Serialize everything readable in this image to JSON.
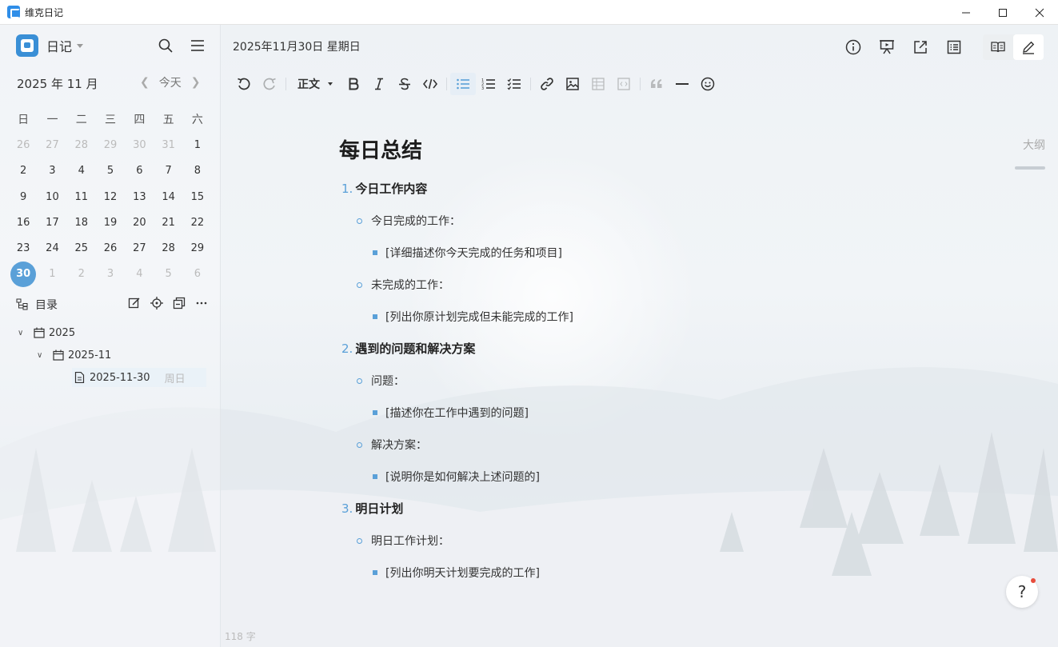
{
  "window": {
    "title": "维克日记",
    "minimize_icon": "minimize-icon",
    "maximize_icon": "maximize-icon",
    "close_icon": "close-icon"
  },
  "sidebar": {
    "title": "日记",
    "month_label": "2025 年 11 月",
    "today_label": "今天",
    "weekdays": [
      "日",
      "一",
      "二",
      "三",
      "四",
      "五",
      "六"
    ],
    "calendar": [
      [
        "26",
        "27",
        "28",
        "29",
        "30",
        "31",
        "1"
      ],
      [
        "2",
        "3",
        "4",
        "5",
        "6",
        "7",
        "8"
      ],
      [
        "9",
        "10",
        "11",
        "12",
        "13",
        "14",
        "15"
      ],
      [
        "16",
        "17",
        "18",
        "19",
        "20",
        "21",
        "22"
      ],
      [
        "23",
        "24",
        "25",
        "26",
        "27",
        "28",
        "29"
      ],
      [
        "30",
        "1",
        "2",
        "3",
        "4",
        "5",
        "6"
      ]
    ],
    "selected_day": "30",
    "toc_title": "目录",
    "tree": {
      "year": "2025",
      "month": "2025-11",
      "entry": "2025-11-30",
      "entry_weekday": "周日"
    }
  },
  "main": {
    "date_label": "2025年11月30日 星期日",
    "style_select": "正文",
    "outline_label": "大纲",
    "word_count": "118 字",
    "help_label": "?",
    "doc": {
      "title": "每日总结",
      "sections": [
        {
          "num": "1.",
          "heading": "今日工作内容",
          "items": [
            {
              "label": "今日完成的工作：",
              "detail": "[详细描述你今天完成的任务和项目]"
            },
            {
              "label": "未完成的工作：",
              "detail": "[列出你原计划完成但未能完成的工作]"
            }
          ]
        },
        {
          "num": "2.",
          "heading": "遇到的问题和解决方案",
          "items": [
            {
              "label": "问题：",
              "detail": "[描述你在工作中遇到的问题]"
            },
            {
              "label": "解决方案：",
              "detail": "[说明你是如何解决上述问题的]"
            }
          ]
        },
        {
          "num": "3.",
          "heading": "明日计划",
          "items": [
            {
              "label": "明日工作计划：",
              "detail": "[列出你明天计划要完成的工作]"
            }
          ]
        }
      ]
    }
  },
  "colors": {
    "accent": "#5aa0d8",
    "app_icon": "#2f8ee8"
  }
}
